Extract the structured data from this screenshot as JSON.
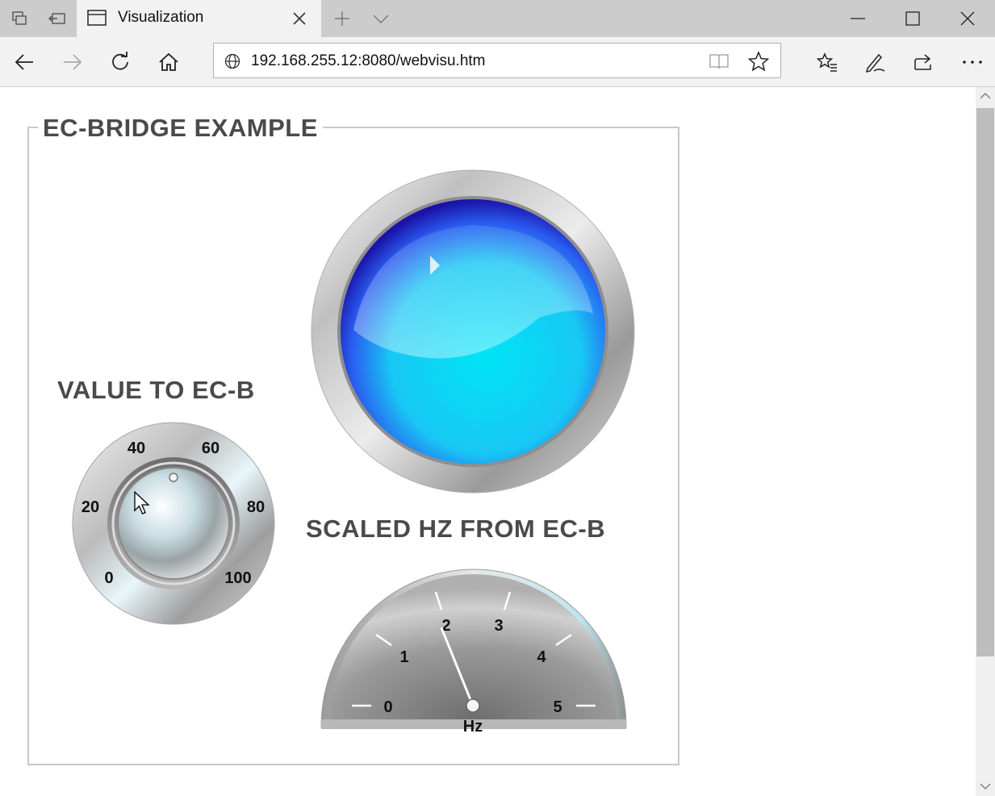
{
  "browser": {
    "tab_title": "Visualization",
    "url": "192.168.255.12:8080/webvisu.htm",
    "icons": {
      "tab_sets": "tab-sets-icon",
      "set_aside": "set-aside-icon",
      "new_tab": "plus-icon",
      "tab_preview": "chevron-down-icon",
      "minimize": "minimize-icon",
      "maximize": "maximize-icon",
      "close": "close-icon",
      "back": "back-arrow-icon",
      "forward": "forward-arrow-icon",
      "refresh": "refresh-icon",
      "home": "home-icon",
      "reading_view": "book-icon",
      "favorite": "star-icon",
      "favorites_hub": "favorites-list-icon",
      "notes": "pen-icon",
      "share": "share-icon",
      "more": "more-dots-icon"
    }
  },
  "visu": {
    "frame_title": "EC-BRIDGE EXAMPLE",
    "knob_label": "VALUE TO EC-B",
    "gauge_label": "SCALED HZ FROM EC-B",
    "knob": {
      "scale_labels": [
        "0",
        "20",
        "40",
        "60",
        "80",
        "100"
      ],
      "value": 50
    },
    "lamp": {
      "color": "#00e4f5",
      "state": "on"
    },
    "gauge": {
      "scale_labels": [
        "0",
        "1",
        "2",
        "3",
        "4",
        "5"
      ],
      "unit": "Hz",
      "value": 2.05,
      "min": 0,
      "max": 5
    }
  }
}
